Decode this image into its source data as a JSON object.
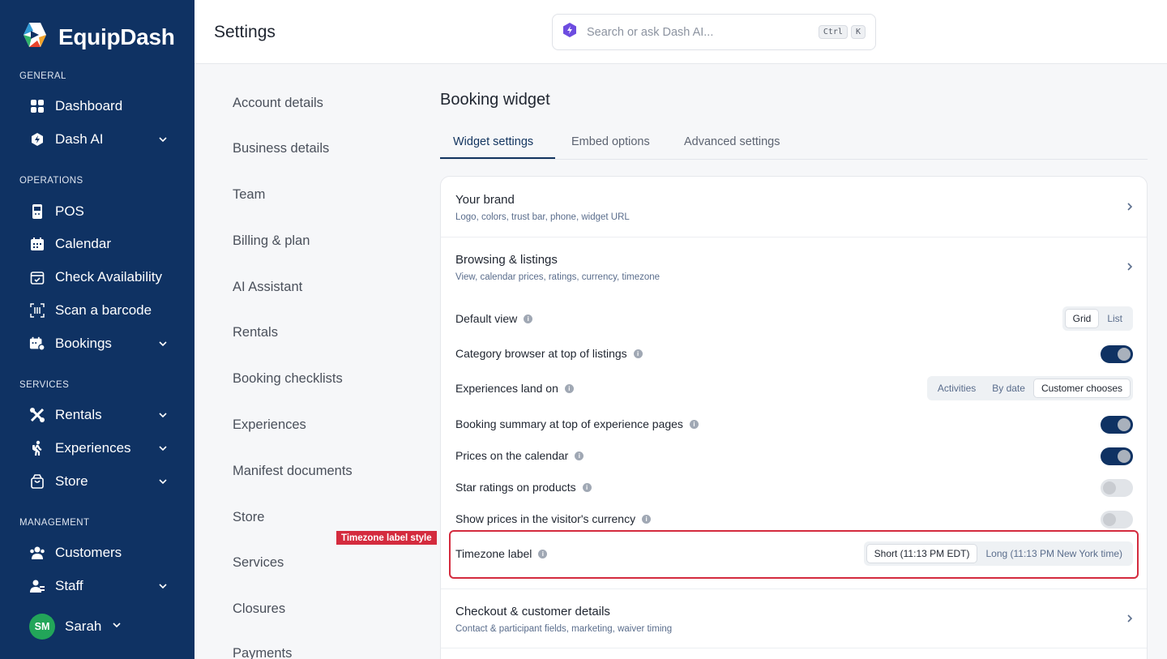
{
  "app": {
    "name": "EquipDash",
    "colors": {
      "sidebar": "#0f3263",
      "accent": "#12345f",
      "highlight": "#d42b3e",
      "avatar": "#22a559"
    }
  },
  "sidebar": {
    "sections": [
      {
        "label": "GENERAL"
      },
      {
        "label": "OPERATIONS"
      },
      {
        "label": "SERVICES"
      },
      {
        "label": "MANAGEMENT"
      }
    ],
    "items": [
      {
        "label": "Dashboard",
        "icon": "grid-icon"
      },
      {
        "label": "Dash AI",
        "icon": "ai-shield-icon",
        "expandable": true
      },
      {
        "label": "POS",
        "icon": "pos-terminal-icon"
      },
      {
        "label": "Calendar",
        "icon": "calendar-icon"
      },
      {
        "label": "Check Availability",
        "icon": "calendar-check-icon"
      },
      {
        "label": "Scan a barcode",
        "icon": "barcode-scan-icon"
      },
      {
        "label": "Bookings",
        "icon": "bookings-icon",
        "expandable": true
      },
      {
        "label": "Rentals",
        "icon": "rentals-icon",
        "expandable": true
      },
      {
        "label": "Experiences",
        "icon": "hiker-icon",
        "expandable": true
      },
      {
        "label": "Store",
        "icon": "shopping-bag-icon",
        "expandable": true
      },
      {
        "label": "Customers",
        "icon": "users-icon"
      },
      {
        "label": "Staff",
        "icon": "staff-icon",
        "expandable": true
      }
    ],
    "user": {
      "initials": "SM",
      "name": "Sarah"
    }
  },
  "header": {
    "title": "Settings",
    "search": {
      "placeholder": "Search or ask Dash AI...",
      "shortcut": [
        "Ctrl",
        "K"
      ]
    }
  },
  "settings_menu": [
    "Account details",
    "Business details",
    "Team",
    "Billing & plan",
    "AI Assistant",
    "Rentals",
    "Booking checklists",
    "Experiences",
    "Manifest documents",
    "Store",
    "Services",
    "Closures",
    "Payments"
  ],
  "main": {
    "title": "Booking widget",
    "tabs": [
      {
        "label": "Widget settings",
        "active": true
      },
      {
        "label": "Embed options",
        "active": false
      },
      {
        "label": "Advanced settings",
        "active": false
      }
    ],
    "groups": [
      {
        "title": "Your brand",
        "subtitle": "Logo, colors, trust bar, phone, widget URL"
      },
      {
        "title": "Browsing & listings",
        "subtitle": "View, calendar prices, ratings, currency, timezone"
      },
      {
        "title": "Checkout & customer details",
        "subtitle": "Contact & participant fields, marketing, waiver timing"
      }
    ],
    "settings": {
      "default_view": {
        "label": "Default view",
        "options": [
          "Grid",
          "List"
        ],
        "selected": "Grid"
      },
      "category_browser": {
        "label": "Category browser at top of listings",
        "on": true
      },
      "experiences_land_on": {
        "label": "Experiences land on",
        "options": [
          "Activities",
          "By date",
          "Customer chooses"
        ],
        "selected": "Customer chooses"
      },
      "booking_summary": {
        "label": "Booking summary at top of experience pages",
        "on": true
      },
      "prices_calendar": {
        "label": "Prices on the calendar",
        "on": true
      },
      "star_ratings": {
        "label": "Star ratings on products",
        "on": false
      },
      "visitor_currency": {
        "label": "Show prices in the visitor's currency",
        "on": false
      },
      "timezone_label": {
        "label": "Timezone label",
        "options": [
          "Short (11:13 PM EDT)",
          "Long (11:13 PM New York time)"
        ],
        "selected": "Short (11:13 PM EDT)"
      }
    },
    "highlight_tag": "Timezone label style"
  }
}
